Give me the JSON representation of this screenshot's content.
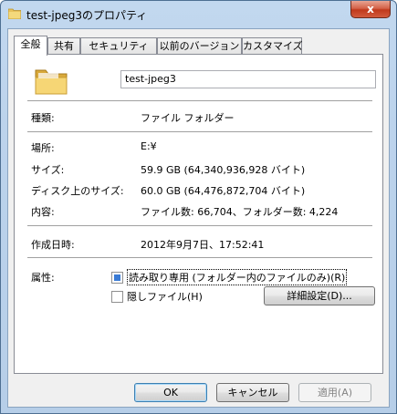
{
  "window": {
    "title": "test-jpeg3のプロパティ",
    "close_label": "x"
  },
  "tabs": [
    {
      "label": "全般",
      "active": true
    },
    {
      "label": "共有"
    },
    {
      "label": "セキュリティ"
    },
    {
      "label": "以前のバージョン"
    },
    {
      "label": "カスタマイズ"
    }
  ],
  "general": {
    "name": "test-jpeg3",
    "type_label": "種類:",
    "type_value": "ファイル フォルダー",
    "location_label": "場所:",
    "location_value": "E:¥",
    "size_label": "サイズ:",
    "size_value": "59.9 GB (64,340,936,928 バイト)",
    "disk_size_label": "ディスク上のサイズ:",
    "disk_size_value": "60.0 GB (64,476,872,704 バイト)",
    "contents_label": "内容:",
    "contents_value": "ファイル数: 66,704、フォルダー数: 4,224",
    "created_label": "作成日時:",
    "created_value": "2012年9月7日、17:52:41",
    "attributes_label": "属性:",
    "readonly_label": "読み取り専用 (フォルダー内のファイルのみ)(R)",
    "hidden_label": "隠しファイル(H)",
    "advanced_button": "詳細設定(D)..."
  },
  "buttons": {
    "ok": "OK",
    "cancel": "キャンセル",
    "apply": "適用(A)"
  },
  "colors": {
    "titlebar": "#bcd3ec",
    "close_button": "#c0391b",
    "checkbox_mixed": "#3a7bd5"
  }
}
